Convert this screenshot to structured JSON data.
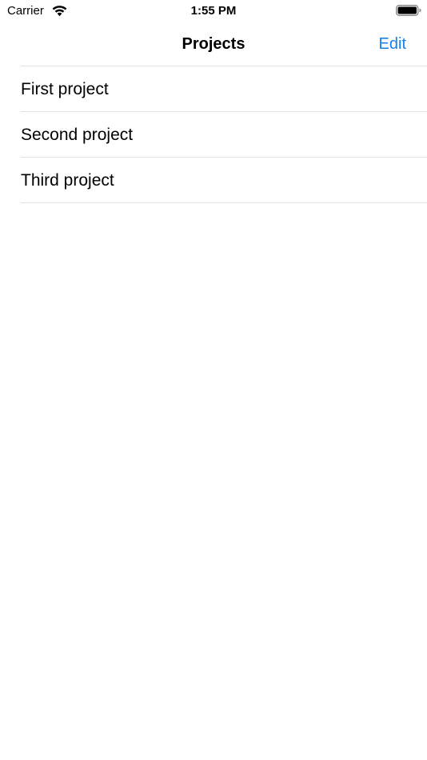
{
  "status_bar": {
    "carrier": "Carrier",
    "time": "1:55 PM",
    "wifi_icon": "wifi-icon",
    "battery_icon": "battery-icon"
  },
  "nav": {
    "title": "Projects",
    "edit_label": "Edit"
  },
  "projects": [
    {
      "label": "First project"
    },
    {
      "label": "Second project"
    },
    {
      "label": "Third project"
    }
  ],
  "colors": {
    "accent": "#1a7ff0",
    "separator": "#e3e3e6",
    "background": "#ffffff"
  }
}
